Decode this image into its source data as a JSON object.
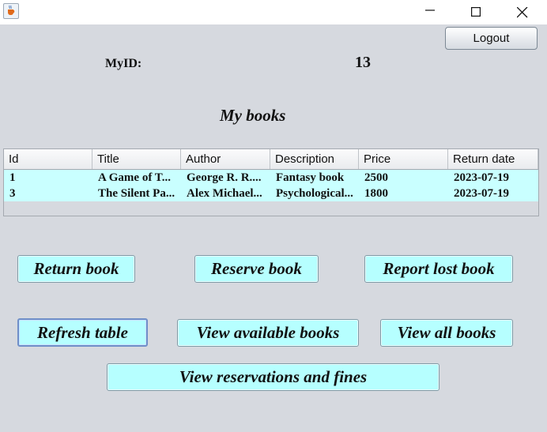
{
  "window": {
    "app_icon": "java-cup-icon",
    "controls": [
      "minimize-icon",
      "maximize-icon",
      "close-icon"
    ]
  },
  "header": {
    "logout_label": "Logout",
    "myid_label": "MyID:",
    "myid_value": "13",
    "heading": "My books"
  },
  "table": {
    "columns": [
      "Id",
      "Title",
      "Author",
      "Description",
      "Price",
      "Return date"
    ],
    "rows": [
      [
        "1",
        "A Game of T...",
        "George R. R....",
        "Fantasy book",
        "2500",
        "2023-07-19"
      ],
      [
        "3",
        "The Silent Pa...",
        "Alex Michael...",
        "Psychological...",
        "1800",
        "2023-07-19"
      ]
    ]
  },
  "actions": {
    "return_book": "Return book",
    "reserve_book": "Reserve book",
    "report_lost_book": "Report lost book",
    "refresh_table": "Refresh table",
    "view_available_books": "View available books",
    "view_all_books": "View all books",
    "view_reservations_and_fines": "View reservations and fines"
  },
  "colors": {
    "button_fill": "#b6ffff",
    "row_fill": "#c9ffff",
    "panel_bg": "#d6d9df"
  }
}
